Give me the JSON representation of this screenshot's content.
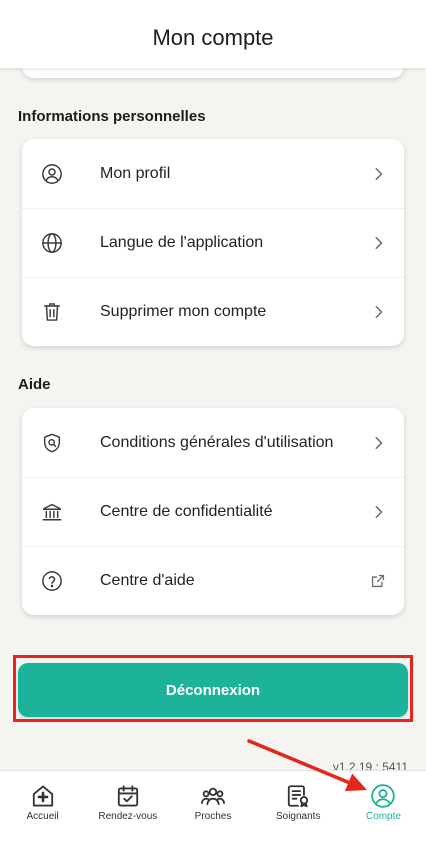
{
  "header": {
    "title": "Mon compte"
  },
  "sections": [
    {
      "title": "Informations personnelles",
      "items": [
        {
          "label": "Mon profil",
          "icon": "user-circle-icon",
          "trailing_icon": "chevron-right-icon"
        },
        {
          "label": "Langue de l'application",
          "icon": "globe-icon",
          "trailing_icon": "chevron-right-icon"
        },
        {
          "label": "Supprimer mon compte",
          "icon": "trash-icon",
          "trailing_icon": "chevron-right-icon"
        }
      ]
    },
    {
      "title": "Aide",
      "items": [
        {
          "label": "Conditions générales d'utilisation",
          "icon": "shield-search-icon",
          "trailing_icon": "chevron-right-icon"
        },
        {
          "label": "Centre de confidentialité",
          "icon": "bank-icon",
          "trailing_icon": "chevron-right-icon"
        },
        {
          "label": "Centre d'aide",
          "icon": "help-circle-icon",
          "trailing_icon": "external-link-icon"
        }
      ]
    }
  ],
  "logout_button": {
    "label": "Déconnexion"
  },
  "version": "v1.2.19 : 5411",
  "tab_bar": {
    "items": [
      {
        "label": "Accueil",
        "icon": "home-plus-icon",
        "active": false
      },
      {
        "label": "Rendez-vous",
        "icon": "calendar-check-icon",
        "active": false
      },
      {
        "label": "Proches",
        "icon": "people-group-icon",
        "active": false
      },
      {
        "label": "Soignants",
        "icon": "caregiver-card-icon",
        "active": false
      },
      {
        "label": "Compte",
        "icon": "user-circle-icon",
        "active": true
      }
    ]
  },
  "colors": {
    "accent": "#1db39b",
    "annotation_red": "#e5261c",
    "background": "#f5f4f0",
    "text": "#1f1f1f"
  }
}
